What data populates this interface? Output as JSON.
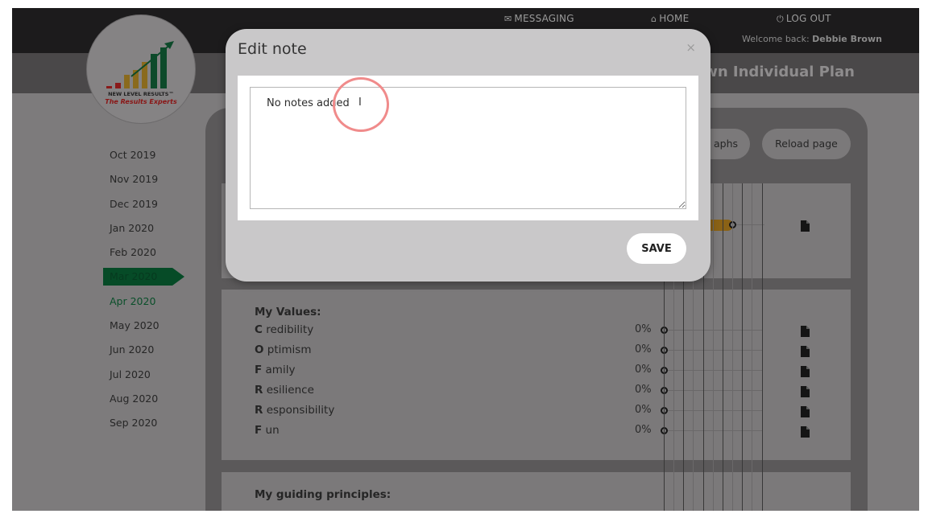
{
  "topnav": {
    "messaging": "MESSAGING",
    "home": "HOME",
    "logout": "LOG OUT",
    "welcome_prefix": "Welcome back:",
    "welcome_user": "Debbie Brown"
  },
  "logo": {
    "line1": "NEW LEVEL RESULTS™",
    "line2": "The Results Experts"
  },
  "page_title": "own Individual Plan",
  "months": [
    {
      "label": "Oct 2019",
      "state": "normal"
    },
    {
      "label": "Nov 2019",
      "state": "normal"
    },
    {
      "label": "Dec 2019",
      "state": "normal"
    },
    {
      "label": "Jan 2020",
      "state": "normal"
    },
    {
      "label": "Feb 2020",
      "state": "normal"
    },
    {
      "label": "Mar 2020",
      "state": "active"
    },
    {
      "label": "Apr 2020",
      "state": "next"
    },
    {
      "label": "May 2020",
      "state": "normal"
    },
    {
      "label": "Jun 2020",
      "state": "normal"
    },
    {
      "label": "Jul 2020",
      "state": "normal"
    },
    {
      "label": "Aug 2020",
      "state": "normal"
    },
    {
      "label": "Sep 2020",
      "state": "normal"
    }
  ],
  "toolbar": {
    "graphs_label": "aphs",
    "reload_label": "Reload page"
  },
  "values_section": {
    "title": "My Values:",
    "rows": [
      {
        "initial": "C",
        "rest": " redibility",
        "percent": "0%"
      },
      {
        "initial": "O",
        "rest": " ptimism",
        "percent": "0%"
      },
      {
        "initial": "F",
        "rest": " amily",
        "percent": "0%"
      },
      {
        "initial": "R",
        "rest": " esilience",
        "percent": "0%"
      },
      {
        "initial": "R",
        "rest": " esponsibility",
        "percent": "0%"
      },
      {
        "initial": "F",
        "rest": " un",
        "percent": "0%"
      }
    ]
  },
  "principles_section": {
    "title": "My guiding principles:"
  },
  "modal": {
    "title": "Edit note",
    "close": "×",
    "note_value": "No notes added",
    "save_label": "SAVE"
  },
  "colors": {
    "accent_green": "#064b27",
    "progress_orange": "#8a6216"
  }
}
